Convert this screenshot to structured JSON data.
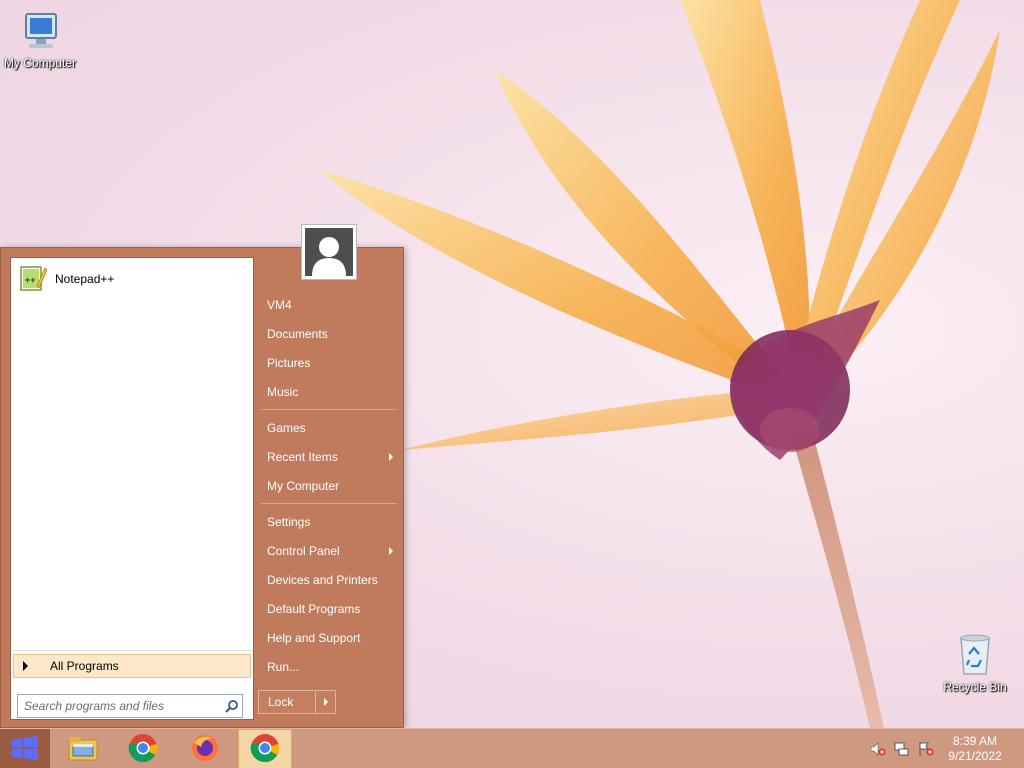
{
  "desktop": {
    "icons": [
      {
        "label": "My Computer",
        "icon": "computer-icon"
      },
      {
        "label": "Recycle Bin",
        "icon": "recycle-bin-icon"
      }
    ]
  },
  "start_menu": {
    "pinned": [
      {
        "label": "Notepad++",
        "icon": "notepadpp-icon"
      }
    ],
    "all_programs_label": "All Programs",
    "search": {
      "placeholder": "Search programs and files",
      "value": ""
    },
    "user_picture_icon": "user-avatar-icon",
    "right_items": [
      {
        "label": "VM4",
        "has_submenu": false
      },
      {
        "label": "Documents",
        "has_submenu": false
      },
      {
        "label": "Pictures",
        "has_submenu": false
      },
      {
        "label": "Music",
        "has_submenu": false
      },
      {
        "label": "Games",
        "has_submenu": false
      },
      {
        "label": "Recent Items",
        "has_submenu": true
      },
      {
        "label": "My Computer",
        "has_submenu": false
      },
      {
        "label": "Settings",
        "has_submenu": false
      },
      {
        "label": "Control Panel",
        "has_submenu": true
      },
      {
        "label": "Devices and Printers",
        "has_submenu": false
      },
      {
        "label": "Default Programs",
        "has_submenu": false
      },
      {
        "label": "Help and Support",
        "has_submenu": false
      },
      {
        "label": "Run...",
        "has_submenu": false
      }
    ],
    "lock_label": "Lock"
  },
  "taskbar": {
    "buttons": [
      {
        "name": "file-explorer",
        "icon": "folder-icon"
      },
      {
        "name": "chrome",
        "icon": "chrome-icon"
      },
      {
        "name": "firefox",
        "icon": "firefox-icon"
      },
      {
        "name": "chrome-active",
        "icon": "chrome-icon",
        "active": true
      }
    ],
    "tray_icons": [
      "speaker-muted-icon",
      "network-icon",
      "action-center-flag-icon"
    ],
    "time": "8:39 AM",
    "date": "9/21/2022"
  },
  "colors": {
    "start_menu_bg": "#c07a5c",
    "taskbar_bg": "#cf9880",
    "all_programs_highlight": "#fde9c9"
  }
}
